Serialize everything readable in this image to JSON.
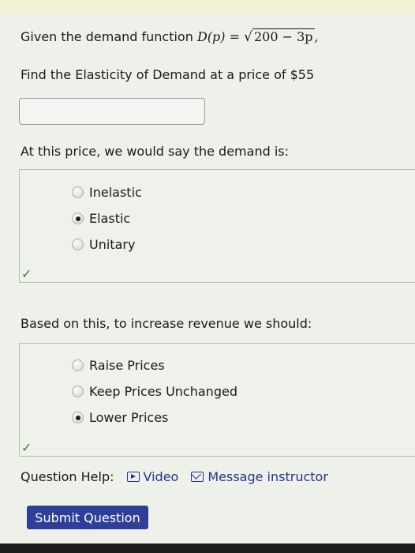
{
  "question1": {
    "prefix": "Given the demand function",
    "function_lhs": "D(p)",
    "equals": "=",
    "radicand": "200 − 3p",
    "suffix": ",",
    "prompt": "Find the Elasticity of Demand at a price of $55",
    "answer_value": ""
  },
  "question2": {
    "prompt": "At this price, we would say the demand is:",
    "options": [
      "Inelastic",
      "Elastic",
      "Unitary"
    ],
    "selected": "Elastic",
    "status_icon": "check-icon"
  },
  "question3": {
    "prompt": "Based on this, to increase revenue we should:",
    "options": [
      "Raise Prices",
      "Keep Prices Unchanged",
      "Lower Prices"
    ],
    "selected": "Lower Prices",
    "status_icon": "check-icon"
  },
  "help": {
    "label": "Question Help:",
    "video_label": "Video",
    "message_label": "Message instructor"
  },
  "submit_label": "Submit Question",
  "colors": {
    "background": "#eef0ea",
    "link": "#26338a",
    "submit_button": "#2f3f98",
    "check": "#2f8a2f"
  }
}
